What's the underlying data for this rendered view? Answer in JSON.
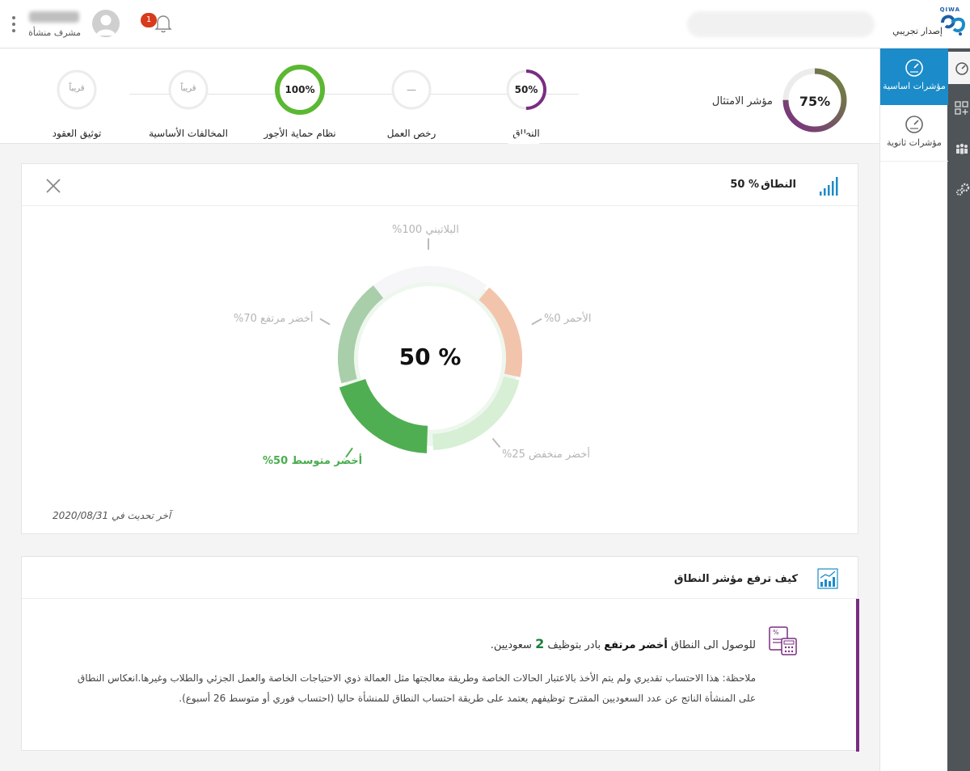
{
  "header": {
    "brand_latin": "QIWA",
    "edition": "إصدار تجريبي",
    "notification_count": "1",
    "user_role": "مشرف منشأة"
  },
  "sidebar": {
    "items": [
      {
        "label": "مؤشرات اساسية",
        "active": true
      },
      {
        "label": "مؤشرات ثانوية",
        "active": false
      }
    ]
  },
  "compliance": {
    "label": "مؤشر الامتثال",
    "value_text": "75%",
    "value": 75
  },
  "steps": [
    {
      "label": "النطاق",
      "value_text": "50%",
      "value": 50,
      "color": "#7a2d82"
    },
    {
      "label": "رخص العمل",
      "value_text": "—",
      "value": 0,
      "color": "#dddddd"
    },
    {
      "label": "نظام حماية الأجور",
      "value_text": "100%",
      "value": 100,
      "color": "#5bb832"
    },
    {
      "label": "المخالفات الأساسية",
      "value_text": "قريباً",
      "value": 0,
      "color": "#dddddd"
    },
    {
      "label": "توثيق العقود",
      "value_text": "قريباً",
      "value": 0,
      "color": "#dddddd"
    }
  ],
  "range_card": {
    "title": "النطاق",
    "title_value": "50 %",
    "center_value": "50 %",
    "segments": [
      {
        "label": "البلاتيني 100%",
        "color": "#f6f6f8",
        "active": false
      },
      {
        "label": "الأحمر 0%",
        "color": "#f3c4ac",
        "active": false
      },
      {
        "label": "أخضر منخفض 25%",
        "color": "#d6efd5",
        "active": false
      },
      {
        "label": "أخضر متوسط 50%",
        "color": "#4fae52",
        "active": true
      },
      {
        "label": "أخضر مرتفع 70%",
        "color": "#a9ceaa",
        "active": false
      }
    ],
    "updated": "آخر تحديث في 2020/08/31"
  },
  "tip_card": {
    "title": "كيف ترفع مؤشر النطاق",
    "main_prefix": "للوصول الى النطاق",
    "main_band": "أخضر مرتفع",
    "main_mid": "بادر بتوظيف",
    "main_count": "2",
    "main_suffix": "سعوديين.",
    "note": "ملاحظة: هذا الاحتساب تقديري ولم يتم الأخذ بالاعتبار الحالات الخاصة وطريقة معالجتها مثل العمالة ذوي الاحتياجات الخاصة والعمل الجزئي والطلاب وغيرها.انعكاس النطاق على المنشأة الناتج عن عدد السعوديين المقترح توظيفهم يعتمد على طريقة احتساب النطاق للمنشأة حاليا (احتساب فوري أو متوسط 26 أسبوع)."
  },
  "colors": {
    "accent_blue": "#1b8bc9",
    "purple": "#7a2d82",
    "green": "#4fae52",
    "rail": "#4f5459"
  }
}
